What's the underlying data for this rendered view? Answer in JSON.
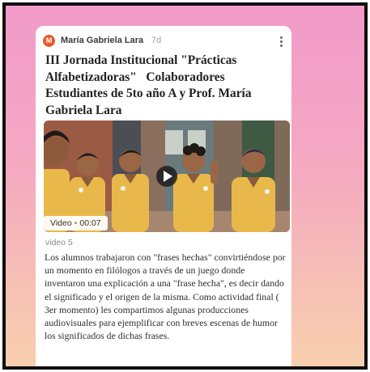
{
  "post": {
    "author_initial": "M",
    "author": "María Gabriela Lara",
    "age": "7d",
    "title": "III Jornada Institucional \"Prácticas Alfabetizadoras\"   Colaboradores Estudiantes de 5to año A y Prof. María Gabriela Lara",
    "video_label": "Video",
    "video_separator": "•",
    "video_duration": "00:07",
    "caption": "video 5",
    "body": "Los alumnos trabajaron con \"frases hechas\" convirtiéndose por un momento en filólogos a través de un juego donde inventaron una explicación a una \"frase hecha\", es decir dando el significado y el origen de la misma. Como actividad final ( 3er momento) les compartimos algunas producciones audiovisuales para ejemplificar con breves escenas de humor los significados de dichas frases."
  },
  "colors": {
    "avatar": "#e85a2c",
    "uniform": "#e8b94a",
    "background_top": "#f29ac9",
    "background_bottom": "#f8cfae"
  },
  "icons": {
    "more": "vertical-ellipsis",
    "play": "play-triangle"
  }
}
